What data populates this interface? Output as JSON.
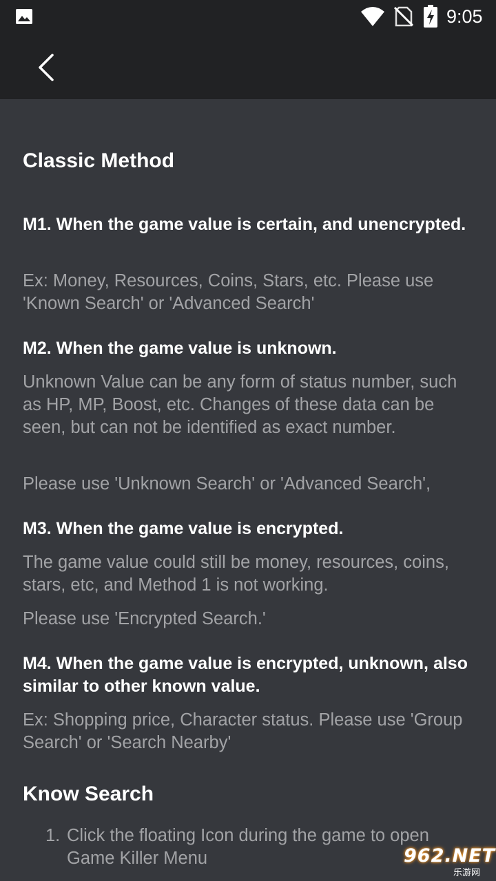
{
  "status_bar": {
    "time": "9:05",
    "icons": [
      "image-notification-icon",
      "wifi-icon",
      "no-sim-icon",
      "battery-charging-icon"
    ]
  },
  "app_bar": {
    "back_icon": "chevron-left-icon"
  },
  "sections": {
    "classic": {
      "title": "Classic Method",
      "m1_head": "M1. When the game value is certain, and unencrypted.",
      "m1_body": "Ex: Money, Resources, Coins, Stars, etc. Please use 'Known Search' or 'Advanced Search'",
      "m2_head": "M2. When the game value is unknown.",
      "m2_body": "Unknown Value can be any form of status number, such as HP, MP, Boost, etc. Changes of these data can be seen, but can not be identified as exact number.",
      "m2_body2": "Please use 'Unknown Search' or 'Advanced Search',",
      "m3_head": "M3. When the game value is encrypted.",
      "m3_body": "The game value could still be money, resources, coins, stars, etc, and Method 1 is not working.",
      "m3_body2": "Please use 'Encrypted Search.'",
      "m4_head": "M4. When the game value is encrypted, unknown, also similar to other known value.",
      "m4_body": "Ex: Shopping price, Character status. Please use 'Group Search' or 'Search Nearby'"
    },
    "know_search": {
      "title": "Know Search",
      "step1_num": "1.",
      "step1_text": "Click the floating Icon during the game to open Game Killer Menu"
    }
  },
  "watermark": {
    "main": "962.NET",
    "sub": "乐游网"
  },
  "colors": {
    "background": "#36383d",
    "bar": "#212224",
    "heading": "#ffffff",
    "body_text": "#a2a3a6"
  }
}
